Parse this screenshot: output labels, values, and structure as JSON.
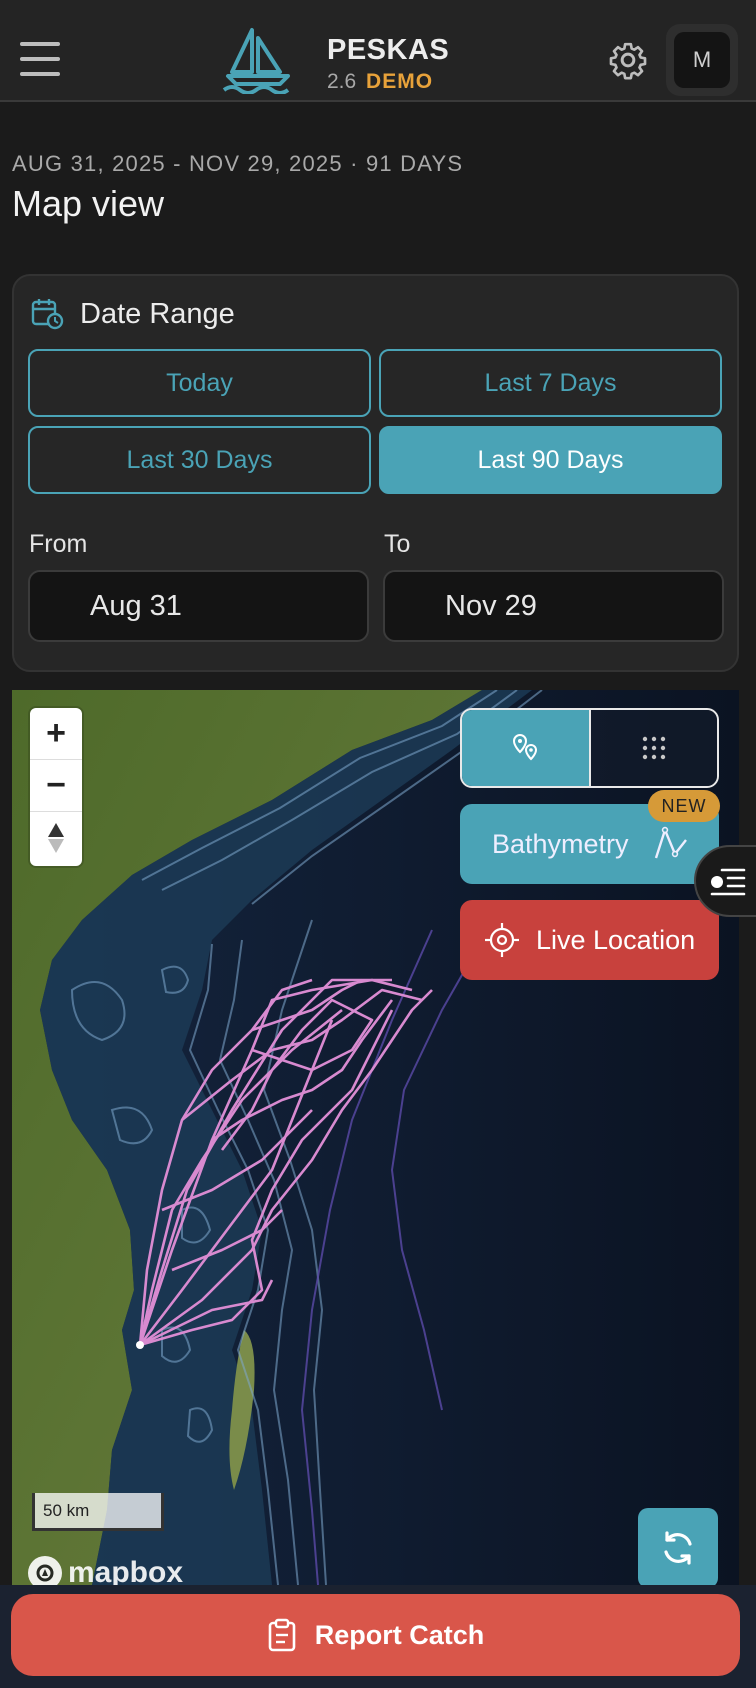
{
  "header": {
    "app_name": "PESKAS",
    "version": "2.6",
    "env_label": "DEMO",
    "avatar_initial": "M",
    "menu_icon": "hamburger-menu-icon",
    "settings_icon": "gear-icon"
  },
  "page": {
    "date_caption": "AUG 31, 2025 - NOV 29, 2025 · 91 DAYS",
    "title": "Map view"
  },
  "date_range": {
    "title": "Date Range",
    "options": [
      "Today",
      "Last 7 Days",
      "Last 30 Days",
      "Last 90 Days"
    ],
    "selected": "Last 90 Days",
    "from_label": "From",
    "from_value": "Aug 31",
    "to_label": "To",
    "to_value": "Nov 29"
  },
  "map": {
    "layer_toggle": {
      "active": "tracks",
      "options": [
        "tracks",
        "grid"
      ]
    },
    "bathymetry_label": "Bathymetry",
    "new_badge": "NEW",
    "live_location_label": "Live Location",
    "scale_label": "50 km",
    "attribution": "mapbox",
    "track_color": "#d88ad0"
  },
  "actions": {
    "report_label": "Report Catch"
  },
  "colors": {
    "accent": "#4aa3b6",
    "danger": "#c8413d",
    "report": "#d9564a",
    "demo": "#e8a23a"
  }
}
